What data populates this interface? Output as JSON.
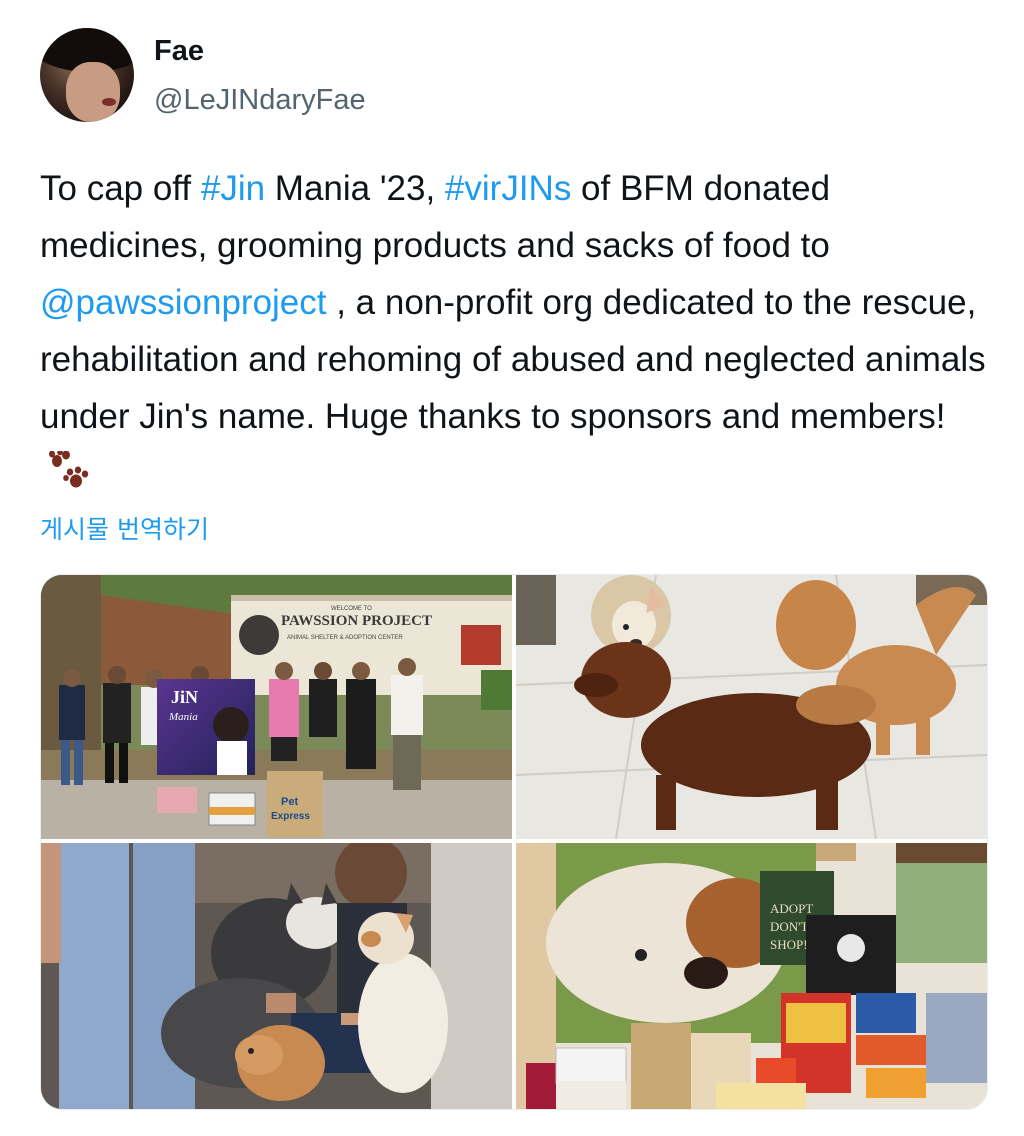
{
  "author": {
    "display_name": "Fae",
    "handle": "@LeJINdaryFae"
  },
  "tweet": {
    "part1": "To cap off ",
    "hashtag1": "#Jin",
    "part2": " Mania '23, ",
    "hashtag2": "#virJINs",
    "part3": " of BFM donated medicines, grooming products and sacks of food to ",
    "mention": "@pawssionproject",
    "part4": " , a non-profit org dedicated to the rescue, rehabilitation and rehoming of abused and neglected animals under Jin's name. Huge thanks to sponsors and members!",
    "emoji_icon": "paw-prints-icon"
  },
  "translate_label": "게시물 번역하기",
  "media": {
    "photo1": {
      "sign_welcome": "WELCOME TO",
      "sign_title": "PAWSSION PROJECT",
      "sign_subtitle": "ANIMAL SHELTER & ADOPTION CENTER",
      "banner_name": "JiN",
      "banner_sub": "Mania",
      "bag_label1": "Pet",
      "bag_label2": "Express"
    },
    "photo4": {
      "poster_line1": "ADOPT",
      "poster_line2": "DON'T",
      "poster_line3": "SHOP!"
    }
  },
  "colors": {
    "link": "#1d9bf0",
    "secondary_text": "#536471",
    "paw": "#7a2d1f"
  }
}
